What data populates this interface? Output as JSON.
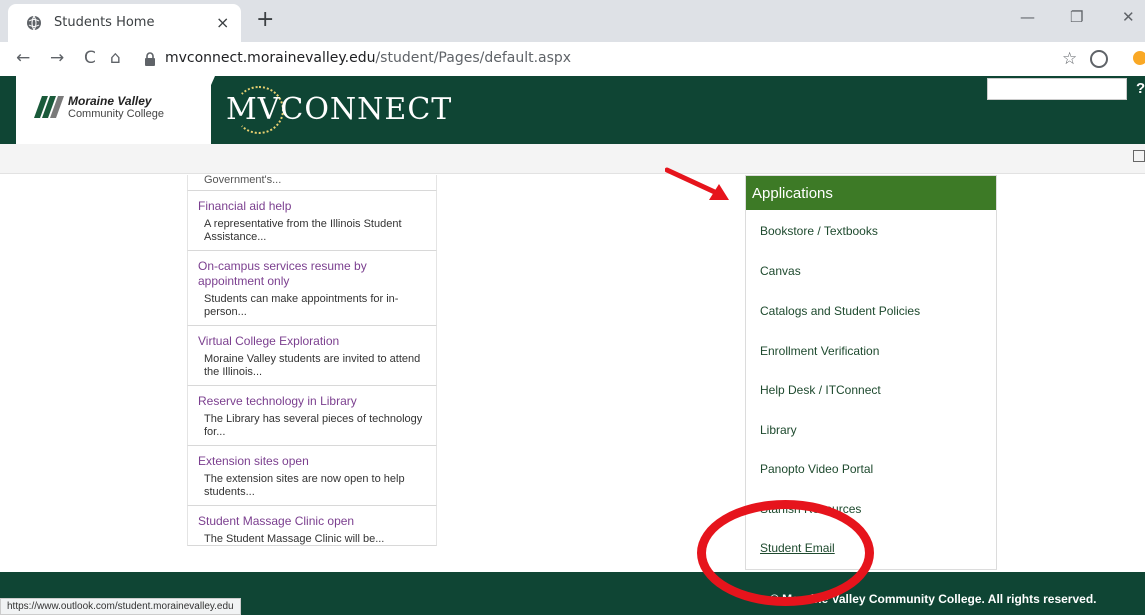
{
  "browser": {
    "tab_title": "Students Home",
    "tab_close": "×",
    "new_tab": "+",
    "url_host": "mvconnect.morainevalley.edu",
    "url_path": "/student/Pages/default.aspx",
    "status_url": "https://www.outlook.com/student.morainevalley.edu",
    "controls": {
      "minimize": "—",
      "restore": "❐",
      "close": "✕"
    },
    "nav": {
      "back": "←",
      "forward": "→",
      "reload": "C",
      "home": "⌂"
    },
    "star": "☆"
  },
  "header": {
    "logo_line1": "Moraine Valley",
    "logo_line2": "Community College",
    "brand": "MVCONNECT",
    "help": "?"
  },
  "news": {
    "truncated_top": "Government's...",
    "items": [
      {
        "title": "Financial aid help",
        "summary": "A representative from the Illinois Student Assistance..."
      },
      {
        "title": "On-campus services resume by appointment only",
        "summary": "Students can make appointments for in-person..."
      },
      {
        "title": "Virtual College Exploration",
        "summary": "Moraine Valley students are invited to attend the Illinois..."
      },
      {
        "title": "Reserve technology in Library",
        "summary": "The Library has several pieces of technology for..."
      },
      {
        "title": "Extension sites open",
        "summary": "The extension sites are now open to help students..."
      },
      {
        "title": "Student Massage Clinic open",
        "summary": "The Student Massage Clinic will be..."
      }
    ]
  },
  "applications": {
    "heading": "Applications",
    "links": [
      "Bookstore / Textbooks",
      "Canvas",
      "Catalogs and Student Policies",
      "Enrollment Verification",
      "Help Desk / ITConnect",
      "Library",
      "Panopto Video Portal",
      "Starfish Resources",
      "Student Email"
    ]
  },
  "footer": {
    "copyright": "© Moraine Valley Community College. All rights reserved."
  },
  "annotation_colors": {
    "highlight": "#e6141c",
    "header_green": "#0f4534",
    "apps_green": "#3d7a26"
  }
}
